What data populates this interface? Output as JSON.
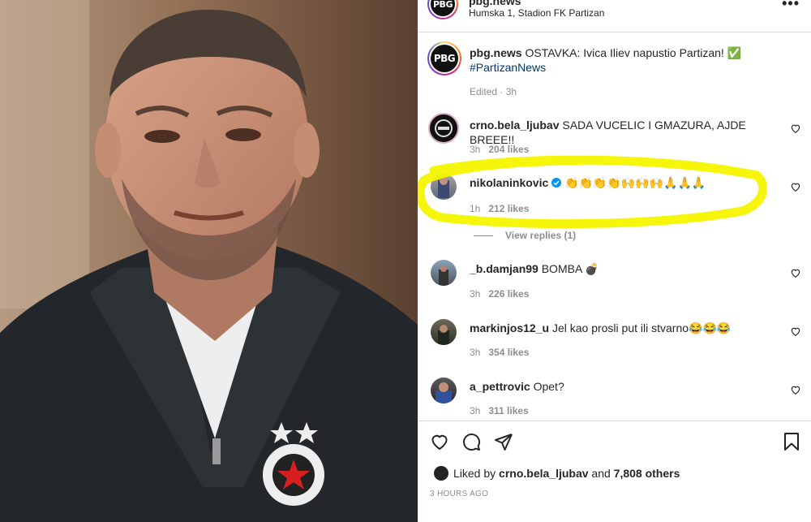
{
  "header": {
    "username": "pbg.news",
    "location": "Humska 1, Stadion FK Partizan",
    "more_glyph": "•••",
    "avatar_text": "PBG"
  },
  "caption": {
    "username": "pbg.news",
    "text": "OSTAVKA: Ivica Iliev napustio Partizan! ✅",
    "hashtag": "#PartizanNews",
    "meta": "Edited · 3h"
  },
  "comments": [
    {
      "username": "crno.bela_ljubav",
      "text": "SADA VUCELIC I GMAZURA, AJDE BREEE!!",
      "time": "3h",
      "likes": "204 likes"
    },
    {
      "username": "nikolaninkovic",
      "verified": true,
      "text": "👏👏👏👏🙌🙌🙌🙏🙏🙏",
      "time": "1h",
      "likes": "212 likes"
    },
    {
      "username": "_b.damjan99",
      "text": "BOMBA 💣",
      "time": "3h",
      "likes": "226 likes"
    },
    {
      "username": "markinjos12_u",
      "text": "Jel kao prosli put ili stvarno😂😂😂",
      "time": "3h",
      "likes": "354 likes"
    },
    {
      "username": "a_pettrovic",
      "text": "Opet?",
      "time": "3h",
      "likes": "311 likes"
    }
  ],
  "view_replies": "View replies (1)",
  "liked_by": {
    "prefix": "Liked by ",
    "user": "crno.bela_ljubav",
    "middle": " and ",
    "others": "7,808 others"
  },
  "time_ago": "3 HOURS AGO",
  "icons": [
    "heart-icon",
    "comment-icon",
    "share-icon",
    "bookmark-icon",
    "more-options-icon",
    "verified-badge-icon"
  ],
  "colors": {
    "highlight": "#f5f500",
    "hashtag": "#00376b",
    "meta": "#8e8e8e",
    "verified": "#0095f6"
  }
}
